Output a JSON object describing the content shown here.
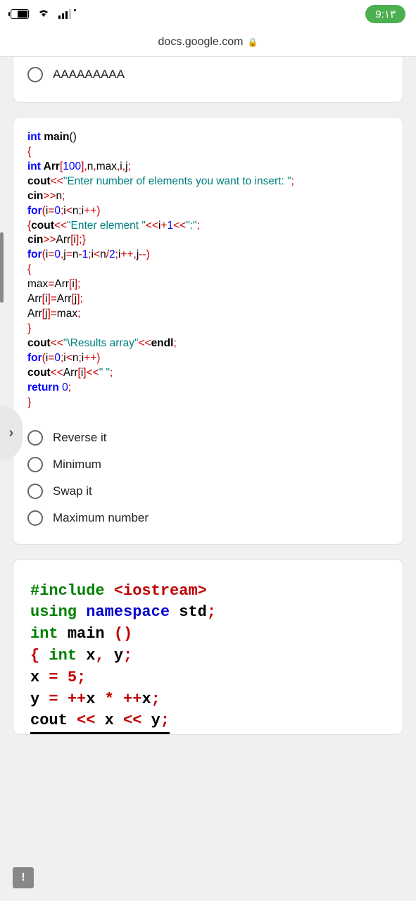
{
  "status_bar": {
    "time": "9:۱۳"
  },
  "url_bar": {
    "domain": "docs.google.com"
  },
  "question1": {
    "option_prev": "AAAAAAAAA"
  },
  "code1": {
    "l1_a": "int",
    "l1_b": " main",
    "l1_c": "()",
    "l2": "{",
    "l3_a": "int",
    "l3_b": " Arr",
    "l3_c": "[",
    "l3_d": "100",
    "l3_e": "],",
    "l3_f": "n",
    "l3_g": ",",
    "l3_h": "max",
    "l3_i": ",",
    "l3_j": "i",
    "l3_k": ",",
    "l3_l": "j",
    "l3_m": ";",
    "l4_a": "cout",
    "l4_b": "<<",
    "l4_c": "\"Enter number of elements you want to insert: \"",
    "l4_d": ";",
    "l5_a": "cin",
    "l5_b": ">>",
    "l5_c": "n",
    "l5_d": ";",
    "l6_a": "for",
    "l6_b": "(",
    "l6_c": "i",
    "l6_d": "=",
    "l6_e": "0",
    "l6_f": ";",
    "l6_g": "i",
    "l6_h": "<",
    "l6_i": "n",
    "l6_j": ";",
    "l6_k": "i",
    "l6_l": "++)",
    "l7_a": "{",
    "l7_b": "cout",
    "l7_c": "<<",
    "l7_d": "\"Enter element \"",
    "l7_e": "<<",
    "l7_f": "i",
    "l7_g": "+",
    "l7_h": "1",
    "l7_i": "<<",
    "l7_j": "\":\"",
    "l7_k": ";",
    "l8_a": "cin",
    "l8_b": ">>",
    "l8_c": "Arr",
    "l8_d": "[",
    "l8_e": "i",
    "l8_f": "];}",
    "l9_a": "for",
    "l9_b": "(",
    "l9_c": "i",
    "l9_d": "=",
    "l9_e": "0",
    "l9_f": ",",
    "l9_g": "j",
    "l9_h": "=",
    "l9_i": "n",
    "l9_j": "-",
    "l9_k": "1",
    "l9_l": ";",
    "l9_m": "i",
    "l9_n": "<",
    "l9_o": "n",
    "l9_p": "/",
    "l9_q": "2",
    "l9_r": ";",
    "l9_s": "i",
    "l9_t": "++,",
    "l9_u": "j",
    "l9_v": "--)",
    "l10": "{",
    "l11_a": "max",
    "l11_b": "=",
    "l11_c": "Arr",
    "l11_d": "[",
    "l11_e": "i",
    "l11_f": "];",
    "l12_a": "Arr",
    "l12_b": "[",
    "l12_c": "i",
    "l12_d": "]=",
    "l12_e": "Arr",
    "l12_f": "[",
    "l12_g": "j",
    "l12_h": "];",
    "l13_a": "Arr",
    "l13_b": "[",
    "l13_c": "j",
    "l13_d": "]=",
    "l13_e": "max",
    "l13_f": ";",
    "l14": "}",
    "l15_a": "cout",
    "l15_b": "<<",
    "l15_c": "\"\\Results  array\"",
    "l15_d": "<<",
    "l15_e": "endl",
    "l15_f": ";",
    "l16_a": "for",
    "l16_b": "(",
    "l16_c": "i",
    "l16_d": "=",
    "l16_e": "0",
    "l16_f": ";",
    "l16_g": "i",
    "l16_h": "<",
    "l16_i": "n",
    "l16_j": ";",
    "l16_k": "i",
    "l16_l": "++)",
    "l17_a": "cout",
    "l17_b": "<<",
    "l17_c": "Arr",
    "l17_d": "[",
    "l17_e": "i",
    "l17_f": "]",
    "l17_g": "<<",
    "l17_h": "\" \"",
    "l17_i": ";",
    "l18_a": "return",
    "l18_b": " 0",
    "l18_c": ";",
    "l19": "}"
  },
  "question2": {
    "options": {
      "a": "Reverse it",
      "b": "Minimum",
      "c": "Swap it",
      "d": "Maximum number"
    }
  },
  "code2": {
    "l1_a": "#include ",
    "l1_b": "<iostream>",
    "l2_a": "using ",
    "l2_b": "namespace ",
    "l2_c": "std",
    "l2_d": ";",
    "l3_a": "int ",
    "l3_b": "main ",
    "l3_c": "()",
    "l4_a": "{",
    "l4_b": "    ",
    "l4_c": "int ",
    "l4_d": "x",
    "l4_e": ", ",
    "l4_f": "y",
    "l4_g": ";",
    "l5_a": "     x ",
    "l5_b": "= ",
    "l5_c": " 5",
    "l5_d": ";",
    "l6_a": "     y ",
    "l6_b": "= ",
    "l6_c": "++",
    "l6_d": "x ",
    "l6_e": "* ",
    "l6_f": "++",
    "l6_g": "x",
    "l6_h": ";",
    "l7_a": "     cout ",
    "l7_b": "<< ",
    "l7_c": "x ",
    "l7_d": "<< ",
    "l7_e": "y",
    "l7_f": ";"
  },
  "side_handle": "›",
  "feedback": "!"
}
